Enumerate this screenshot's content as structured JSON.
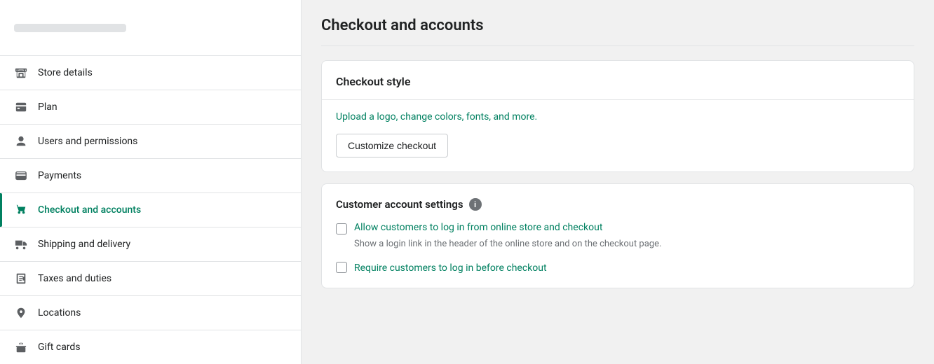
{
  "sidebar": {
    "top_placeholder": "...",
    "items": [
      {
        "id": "store-details",
        "label": "Store details",
        "icon": "store",
        "active": false
      },
      {
        "id": "plan",
        "label": "Plan",
        "icon": "plan",
        "active": false
      },
      {
        "id": "users-permissions",
        "label": "Users and permissions",
        "icon": "user",
        "active": false
      },
      {
        "id": "payments",
        "label": "Payments",
        "icon": "payments",
        "active": false
      },
      {
        "id": "checkout-accounts",
        "label": "Checkout and accounts",
        "icon": "cart",
        "active": true
      },
      {
        "id": "shipping-delivery",
        "label": "Shipping and delivery",
        "icon": "shipping",
        "active": false
      },
      {
        "id": "taxes-duties",
        "label": "Taxes and duties",
        "icon": "taxes",
        "active": false
      },
      {
        "id": "locations",
        "label": "Locations",
        "icon": "location",
        "active": false
      },
      {
        "id": "gift-cards",
        "label": "Gift cards",
        "icon": "gift",
        "active": false
      }
    ]
  },
  "main": {
    "page_title": "Checkout and accounts",
    "checkout_style": {
      "title": "Checkout style",
      "upload_text": "Upload a logo, change colors, fonts, and more.",
      "customize_btn": "Customize checkout"
    },
    "customer_account_settings": {
      "title": "Customer account settings",
      "checkbox1": {
        "link_text": "Allow customers to log in from online store and checkout",
        "sub_text": "Show a login link in the header of the online store and on the checkout page."
      },
      "checkbox2": {
        "link_text": "Require customers to log in before checkout"
      }
    }
  }
}
